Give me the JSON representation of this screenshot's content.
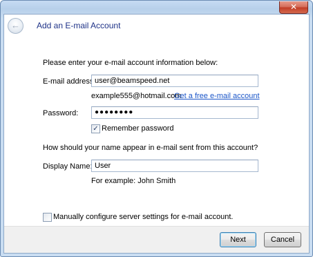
{
  "window": {
    "close_label": "✕",
    "title": "Add an E-mail Account",
    "back_icon": "←"
  },
  "form": {
    "intro": "Please enter your e-mail account information below:",
    "email_label": "E-mail address:",
    "email_value": "user@beamspeed.net",
    "email_example": "example555@hotmail.com",
    "free_account_link": "Get a free e-mail account",
    "password_label": "Password:",
    "password_value": "●●●●●●●●",
    "remember_checked_glyph": "✓",
    "remember_label": "Remember password",
    "name_question": "How should your name appear in e-mail sent from this account?",
    "display_name_label": "Display Name:",
    "display_name_value": "User",
    "display_name_example": "For example: John Smith",
    "manual_config_glyph": "",
    "manual_config_label": "Manually configure server settings for e-mail account."
  },
  "footer": {
    "next_label": "Next",
    "cancel_label": "Cancel"
  }
}
